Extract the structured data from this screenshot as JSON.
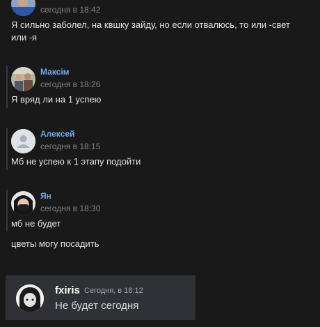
{
  "messages": [
    {
      "time": "сегодня в 18:42",
      "lines": [
        "Я сильно заболел, на квшку зайду, но если отвалюсь, то или -свет",
        "или -я"
      ]
    },
    {
      "author": "Максім",
      "time": "сегодня в 18:26",
      "lines": [
        "Я вряд ли на 1 успею"
      ]
    },
    {
      "author": "Алексей",
      "time": "сегодня в 18:15",
      "lines": [
        "Мб не успею к 1 этапу подойти"
      ]
    },
    {
      "author": "Ян",
      "time": "сегодня в 18:30",
      "lines": [
        "мб не будет",
        "цветы могу посадить"
      ]
    }
  ],
  "embed": {
    "username": "fxiris",
    "time": "Сегодня, в 18:12",
    "text": "Не будет сегодня"
  },
  "colors": {
    "background": "#19191a",
    "author_link": "#71aaeb",
    "timestamp": "#828282",
    "embed_bg": "#2f3136"
  }
}
